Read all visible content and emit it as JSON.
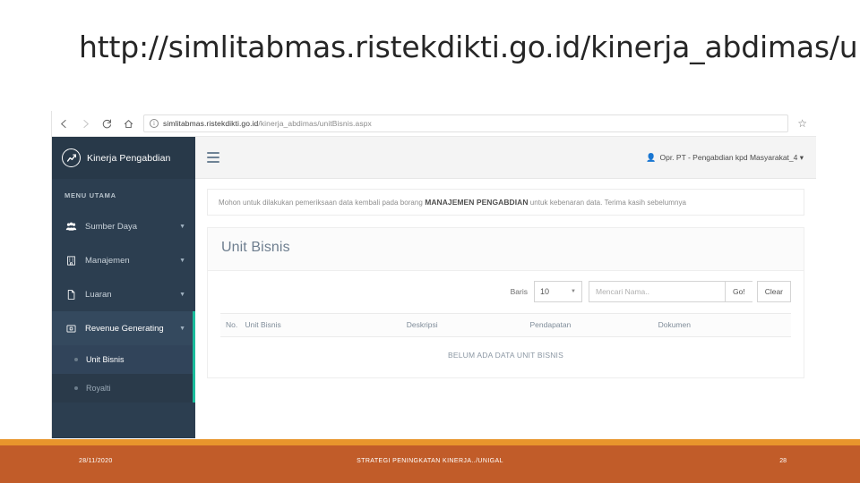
{
  "slide": {
    "title": "http://simlitabmas.ristekdikti.go.id/kinerja_abdimas/unitBisnis.aspx"
  },
  "browser": {
    "back_icon": "back-arrow-icon",
    "forward_icon": "forward-arrow-icon",
    "reload_icon": "reload-icon",
    "home_icon": "home-icon",
    "info_icon": "info-circle-icon",
    "url_prefix": "simlitabmas.ristekdikti.go.id",
    "url_path": "/kinerja_abdimas/unitBisnis.aspx",
    "star_icon": "star-bookmark-icon"
  },
  "app": {
    "brand": {
      "logo_icon": "chart-line-circle-icon",
      "name": "Kinerja Pengabdian"
    },
    "topbar": {
      "menu_toggle_icon": "hamburger-menu-icon",
      "user_icon": "user-icon",
      "user_label": "Opr. PT - Pengabdian kpd Masyarakat_4 ▾"
    },
    "sidebar": {
      "heading": "MENU UTAMA",
      "items": [
        {
          "label": "Sumber Daya",
          "icon": "users-group-icon",
          "caret": "▼",
          "active": false
        },
        {
          "label": "Manajemen",
          "icon": "building-icon",
          "caret": "▼",
          "active": false
        },
        {
          "label": "Luaran",
          "icon": "file-icon",
          "caret": "▼",
          "active": false
        },
        {
          "label": "Revenue Generating",
          "icon": "money-card-icon",
          "caret": "▼",
          "active": true
        }
      ],
      "subitems": [
        {
          "label": "Unit Bisnis",
          "active": true
        },
        {
          "label": "Royalti",
          "active": false
        }
      ]
    },
    "alert": {
      "text_before": "Mohon untuk dilakukan pemeriksaan data kembali pada borang ",
      "emphasis": "MANAJEMEN PENGABDIAN",
      "text_after": " untuk kebenaran data. Terima kasih sebelumnya"
    },
    "page": {
      "title": "Unit Bisnis"
    },
    "toolbar": {
      "rows_label": "Baris",
      "rows_value": "10",
      "rows_caret": "▼",
      "search_placeholder": "Mencari Nama..",
      "search_value": "",
      "go_label": "Go!",
      "clear_label": "Clear"
    },
    "table": {
      "headers": [
        "No.",
        "Unit Bisnis",
        "Deskripsi",
        "Pendapatan",
        "Dokumen"
      ],
      "rows": [],
      "empty_message": "BELUM ADA DATA UNIT BISNIS"
    }
  },
  "footer": {
    "date": "28/11/2020",
    "center": "STRATEGI PENINGKATAN KINERJA../UNIGAL",
    "page_number": "28"
  },
  "colors": {
    "sidebar_bg": "#2c3e50",
    "sidebar_brand_bg": "#283949",
    "accent_teal": "#1abc9c",
    "footer_bg": "#c15c29",
    "footer_stripe": "#e8952c"
  }
}
